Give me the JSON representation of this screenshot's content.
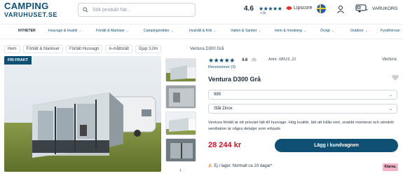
{
  "header": {
    "logo_line1": "CAMPING",
    "logo_line2": "VARUHUSET.SE",
    "search_placeholder": "Sök produkt här...",
    "rating_value": "4.6",
    "rating_stars": "★★★★★",
    "rating_count": "+1k",
    "lipscore": "Lipscore",
    "cart_label": "VARUKORG"
  },
  "nav": {
    "items": [
      {
        "label": "NYHETER"
      },
      {
        "label": "Husvagn & Husbil"
      },
      {
        "label": "Förtält & Markiser"
      },
      {
        "label": "Campingmöbler"
      },
      {
        "label": "Hushåll & Kök"
      },
      {
        "label": "Vatten & Sanitet"
      },
      {
        "label": "Hem & Inredning"
      },
      {
        "label": "Övrigt"
      },
      {
        "label": "Outdoor"
      },
      {
        "label": "Fyndhörnan"
      }
    ]
  },
  "breadcrumb": {
    "items": [
      "Hem",
      "Förtält & Markiser",
      "Förtält Husvagn",
      "A-måttstält",
      "Djup 3,0m"
    ],
    "current": "Ventura D300 Grå"
  },
  "product": {
    "badge": "FRI FRAKT",
    "stars": "★★★★★",
    "rating": "4.6",
    "rating_count": "(8)",
    "reviews_link": "Recensioner (3)",
    "artnr_label": "Artnr:",
    "artnr_value": "68519_21",
    "brand": "Ventura",
    "title": "Ventura D300 Grå",
    "select_size": "989",
    "select_frame": "Stål Zinox",
    "description": "Ventura förtält är ett prisvärt tält till husvagn. Hög kvalité, lätt att hålla rent, snabbt monterat och utmärkt ventilation är några detaljer som erbjuds",
    "price": "28 244 kr",
    "buy_label": "Lägg i kundvagnen",
    "stock_text": "Ej i lager. Normalt ca 10 dagar*",
    "klarna": "Klarna."
  },
  "colors": {
    "brand": "#0f4f73",
    "price": "#c8142a",
    "klarna": "#f5b3c7"
  }
}
